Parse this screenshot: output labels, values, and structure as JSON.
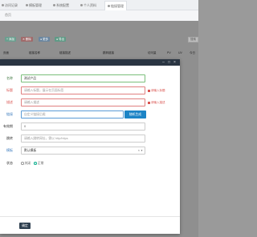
{
  "tabs": [
    {
      "label": "访问记录",
      "active": false
    },
    {
      "label": "模板管理",
      "active": false
    },
    {
      "label": "系统配置",
      "active": false
    },
    {
      "label": "个人资料",
      "active": false
    },
    {
      "label": "链接管理",
      "active": true
    }
  ],
  "subtab": "首页",
  "toolbar": {
    "add": "添加",
    "edit": "删除",
    "more": "更多",
    "export": "导出",
    "search": "搜索"
  },
  "table_headers": [
    "页面",
    "链接名称",
    "链接描述",
    "跳转链接",
    "访问量",
    "PV",
    "UV",
    "今日"
  ],
  "form": {
    "fields": [
      {
        "label": "名称",
        "value": "测试产品",
        "state": "ok",
        "hint": ""
      },
      {
        "label": "标题",
        "placeholder": "请输入标题，展示在页面标签",
        "state": "err",
        "hint": "请输入标题"
      },
      {
        "label": "描述",
        "placeholder": "请输入描述",
        "state": "err",
        "hint": "请输入描述"
      },
      {
        "label": "链接",
        "placeholder": "自定义链接后缀",
        "state": "blue",
        "hint": ""
      },
      {
        "label": "有效期",
        "value": "0",
        "state": "normal",
        "hint": ""
      },
      {
        "label": "跳转",
        "placeholder": "请输入跳转网址，需以 http/https",
        "state": "normal",
        "hint": ""
      },
      {
        "label": "模板",
        "value": "默认模板",
        "state": "normal",
        "hint": ""
      }
    ],
    "generate_label": "随机生成",
    "status_label": "状态",
    "radio": [
      {
        "label": "关闭",
        "checked": false
      },
      {
        "label": "正常",
        "checked": true
      }
    ],
    "ok_label": "确定"
  },
  "colors": {
    "header": "#2a3542",
    "primary": "#1c84c6",
    "success": "#1ab394",
    "danger": "#d9534f"
  }
}
